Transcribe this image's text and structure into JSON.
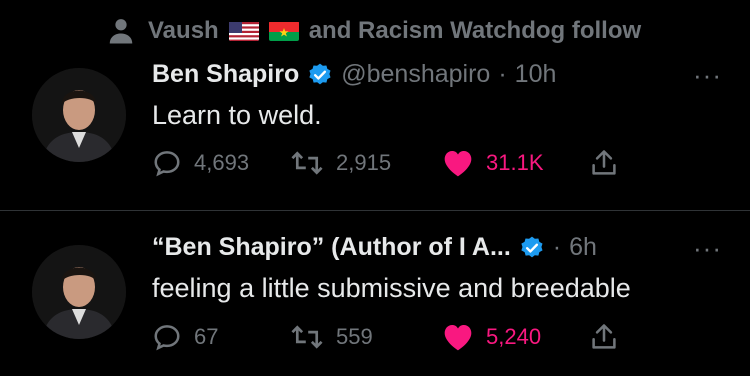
{
  "social_context": {
    "name": "Vaush",
    "suffix": "and Racism Watchdog follow"
  },
  "tweets": [
    {
      "display_name": "Ben Shapiro",
      "handle": "@benshapiro",
      "separator": "·",
      "time": "10h",
      "text": "Learn to weld.",
      "replies": "4,693",
      "retweets": "2,915",
      "likes": "31.1K"
    },
    {
      "display_name": "“Ben Shapiro” (Author of I A...",
      "handle": "",
      "separator": "·",
      "time": "6h",
      "text": "feeling a little submissive and breedable",
      "replies": "67",
      "retweets": "559",
      "likes": "5,240"
    }
  ],
  "icons": {
    "person": "person-icon",
    "verified": "verified-badge-icon",
    "more": "more-icon",
    "reply": "reply-icon",
    "retweet": "retweet-icon",
    "like": "heart-icon",
    "share": "share-icon",
    "flags": [
      "us-flag-icon",
      "burkina-faso-flag-icon"
    ]
  },
  "colors": {
    "background": "#000000",
    "text": "#e7e9ea",
    "muted": "#71767b",
    "verified": "#1d9bf0",
    "like": "#f91880"
  },
  "more_label": "···"
}
